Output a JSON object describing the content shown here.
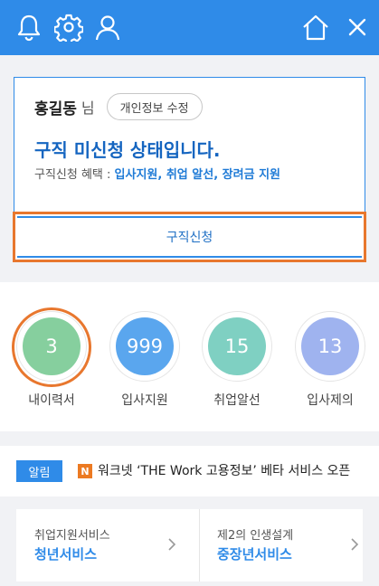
{
  "header": {
    "icons": [
      "bell-icon",
      "gear-icon",
      "person-icon",
      "home-icon",
      "close-icon"
    ],
    "bg_color": "#2f8be8"
  },
  "profile": {
    "name": "홍길동",
    "honorific": "님",
    "edit_button": "개인정보 수정",
    "status": "구직 미신청 상태입니다.",
    "benefit_prefix": "구직신청 혜택 : ",
    "benefits": "입사지원, 취업 알선, 장려금 지원",
    "apply_button": "구직신청"
  },
  "stats": [
    {
      "value": "3",
      "label": "내이력서",
      "color": "#86cf9e"
    },
    {
      "value": "999",
      "label": "입사지원",
      "color": "#5aa6ee"
    },
    {
      "value": "15",
      "label": "취업알선",
      "color": "#7fd0c2"
    },
    {
      "value": "13",
      "label": "입사제의",
      "color": "#9fb3ef"
    }
  ],
  "notice": {
    "badge": "알림",
    "logo": "N",
    "text": "워크넷 ‘THE Work 고용정보’ 베타 서비스 오픈"
  },
  "services": [
    {
      "sub": "취업지원서비스",
      "main": "청년서비스"
    },
    {
      "sub": "제2의 인생설계",
      "main": "중장년서비스"
    }
  ]
}
